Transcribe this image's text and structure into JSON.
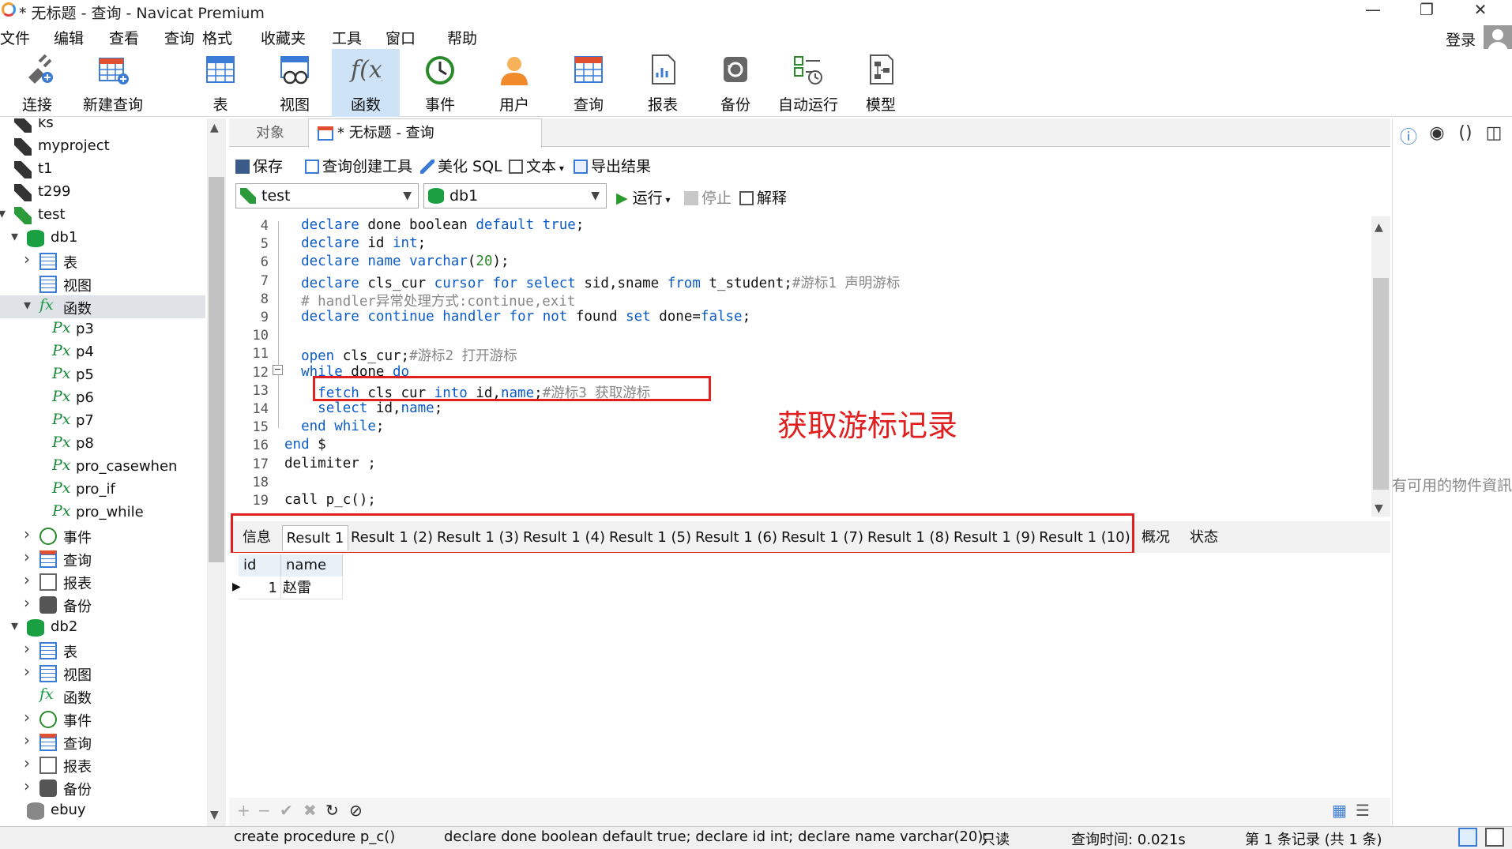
{
  "window": {
    "title": "* 无标题 - 查询 - Navicat Premium",
    "minimize": "—",
    "maximize": "❐",
    "close": "✕"
  },
  "menu": [
    "文件",
    "编辑",
    "查看",
    "查询",
    "格式",
    "收藏夹",
    "工具",
    "窗口",
    "帮助"
  ],
  "login": "登录",
  "toolbar": [
    {
      "label": "连接",
      "icon": "plug-icon"
    },
    {
      "label": "新建查询",
      "icon": "new-query-icon"
    },
    {
      "label": "表",
      "icon": "table-icon"
    },
    {
      "label": "视图",
      "icon": "view-icon"
    },
    {
      "label": "函数",
      "icon": "function-icon"
    },
    {
      "label": "事件",
      "icon": "clock-icon"
    },
    {
      "label": "用户",
      "icon": "user-icon"
    },
    {
      "label": "查询",
      "icon": "query-icon"
    },
    {
      "label": "报表",
      "icon": "report-icon"
    },
    {
      "label": "备份",
      "icon": "backup-icon"
    },
    {
      "label": "自动运行",
      "icon": "schedule-icon"
    },
    {
      "label": "模型",
      "icon": "model-icon"
    }
  ],
  "tree": [
    {
      "label": "ks",
      "icon": "connection-icon",
      "indent": 0
    },
    {
      "label": "myproject",
      "icon": "connection-icon",
      "indent": 0
    },
    {
      "label": "t1",
      "icon": "connection-icon",
      "indent": 0
    },
    {
      "label": "t299",
      "icon": "connection-icon",
      "indent": 0
    },
    {
      "label": "test",
      "icon": "connection-green-icon",
      "indent": 0,
      "chev": "v"
    },
    {
      "label": "db1",
      "icon": "database-icon",
      "indent": 1,
      "chev": "v"
    },
    {
      "label": "表",
      "icon": "table-icon",
      "indent": 2,
      "chev": ">"
    },
    {
      "label": "视图",
      "icon": "view-icon",
      "indent": 2
    },
    {
      "label": "函数",
      "icon": "function-icon",
      "indent": 2,
      "chev": "v",
      "selected": true
    },
    {
      "label": "p3",
      "icon": "procedure-icon",
      "indent": 3
    },
    {
      "label": "p4",
      "icon": "procedure-icon",
      "indent": 3
    },
    {
      "label": "p5",
      "icon": "procedure-icon",
      "indent": 3
    },
    {
      "label": "p6",
      "icon": "procedure-icon",
      "indent": 3
    },
    {
      "label": "p7",
      "icon": "procedure-icon",
      "indent": 3
    },
    {
      "label": "p8",
      "icon": "procedure-icon",
      "indent": 3
    },
    {
      "label": "pro_casewhen",
      "icon": "procedure-icon",
      "indent": 3
    },
    {
      "label": "pro_if",
      "icon": "procedure-icon",
      "indent": 3
    },
    {
      "label": "pro_while",
      "icon": "procedure-icon",
      "indent": 3
    },
    {
      "label": "事件",
      "icon": "clock-icon",
      "indent": 2,
      "chev": ">"
    },
    {
      "label": "查询",
      "icon": "query-icon",
      "indent": 2,
      "chev": ">"
    },
    {
      "label": "报表",
      "icon": "report-icon",
      "indent": 2,
      "chev": ">"
    },
    {
      "label": "备份",
      "icon": "backup-icon",
      "indent": 2,
      "chev": ">"
    },
    {
      "label": "db2",
      "icon": "database-icon",
      "indent": 1,
      "chev": "v"
    },
    {
      "label": "表",
      "icon": "table-icon",
      "indent": 2,
      "chev": ">"
    },
    {
      "label": "视图",
      "icon": "view-icon",
      "indent": 2,
      "chev": ">"
    },
    {
      "label": "函数",
      "icon": "function-icon",
      "indent": 2
    },
    {
      "label": "事件",
      "icon": "clock-icon",
      "indent": 2,
      "chev": ">"
    },
    {
      "label": "查询",
      "icon": "query-icon",
      "indent": 2,
      "chev": ">"
    },
    {
      "label": "报表",
      "icon": "report-icon",
      "indent": 2,
      "chev": ">"
    },
    {
      "label": "备份",
      "icon": "backup-icon",
      "indent": 2,
      "chev": ">"
    },
    {
      "label": "ebuy",
      "icon": "database-gray-icon",
      "indent": 1
    }
  ],
  "tabs": {
    "objects": "对象",
    "query": "* 无标题 - 查询"
  },
  "qtoolbar": {
    "save": "保存",
    "builder": "查询创建工具",
    "beautify": "美化 SQL",
    "text": "文本",
    "export": "导出结果",
    "connection": "test",
    "database": "db1",
    "run": "运行",
    "stop": "停止",
    "explain": "解释"
  },
  "editor": {
    "lines": [
      {
        "n": "4",
        "html": "  <span class='kw'>declare</span> done boolean <span class='kw'>default</span> <span class='kw'>true</span>;"
      },
      {
        "n": "5",
        "html": "  <span class='kw'>declare</span> id <span class='kw'>int</span>;"
      },
      {
        "n": "6",
        "html": "  <span class='kw'>declare</span> <span class='kw'>name</span> <span class='kw'>varchar</span>(<span class='num'>20</span>);"
      },
      {
        "n": "7",
        "html": "  <span class='kw'>declare</span> cls_cur <span class='kw'>cursor</span> <span class='kw'>for</span> <span class='kw'>select</span> sid,sname <span class='kw'>from</span> t_student;<span class='cm'>#游标1 声明游标</span>"
      },
      {
        "n": "8",
        "html": "  <span class='cm'># handler异常处理方式:continue,exit</span>"
      },
      {
        "n": "9",
        "html": "  <span class='kw'>declare</span> <span class='kw'>continue</span> <span class='kw'>handler</span> <span class='kw'>for</span> <span class='kw'>not</span> found <span class='kw'>set</span> done=<span class='kw'>false</span>;"
      },
      {
        "n": "10",
        "html": ""
      },
      {
        "n": "11",
        "html": "  <span class='kw'>open</span> cls_cur;<span class='cm'>#游标2 打开游标</span>"
      },
      {
        "n": "12",
        "html": "  <span class='kw'>while</span> done <span class='kw'>do</span>"
      },
      {
        "n": "13",
        "html": "    <span class='kw'>fetch</span> cls_cur <span class='kw'>into</span> id,<span class='kw'>name</span>;<span class='cm'>#游标3 获取游标</span>"
      },
      {
        "n": "14",
        "html": "    <span class='kw'>select</span> id,<span class='kw'>name</span>;"
      },
      {
        "n": "15",
        "html": "  <span class='kw'>end</span> <span class='kw'>while</span>;"
      },
      {
        "n": "16",
        "html": "<span class='kw'>end</span> $"
      },
      {
        "n": "17",
        "html": "delimiter ;"
      },
      {
        "n": "18",
        "html": ""
      },
      {
        "n": "19",
        "html": "call p_c();"
      }
    ],
    "annotation": "获取游标记录"
  },
  "side_message": "有可用的物件資訊",
  "result_tabs": [
    "信息",
    "Result 1",
    "Result 1 (2)",
    "Result 1 (3)",
    "Result 1 (4)",
    "Result 1 (5)",
    "Result 1 (6)",
    "Result 1 (7)",
    "Result 1 (8)",
    "Result 1 (9)",
    "Result 1 (10)",
    "概况",
    "状态"
  ],
  "grid": {
    "headers": [
      "id",
      "name"
    ],
    "rows": [
      [
        "1",
        "赵雷"
      ]
    ]
  },
  "status": {
    "sql": "create procedure p_c()",
    "sql2": "declare done boolean default true;  declare id int;  declare name varchar(20);",
    "mode": "只读",
    "time": "查询时间: 0.021s",
    "records": "第 1 条记录 (共 1 条)"
  }
}
